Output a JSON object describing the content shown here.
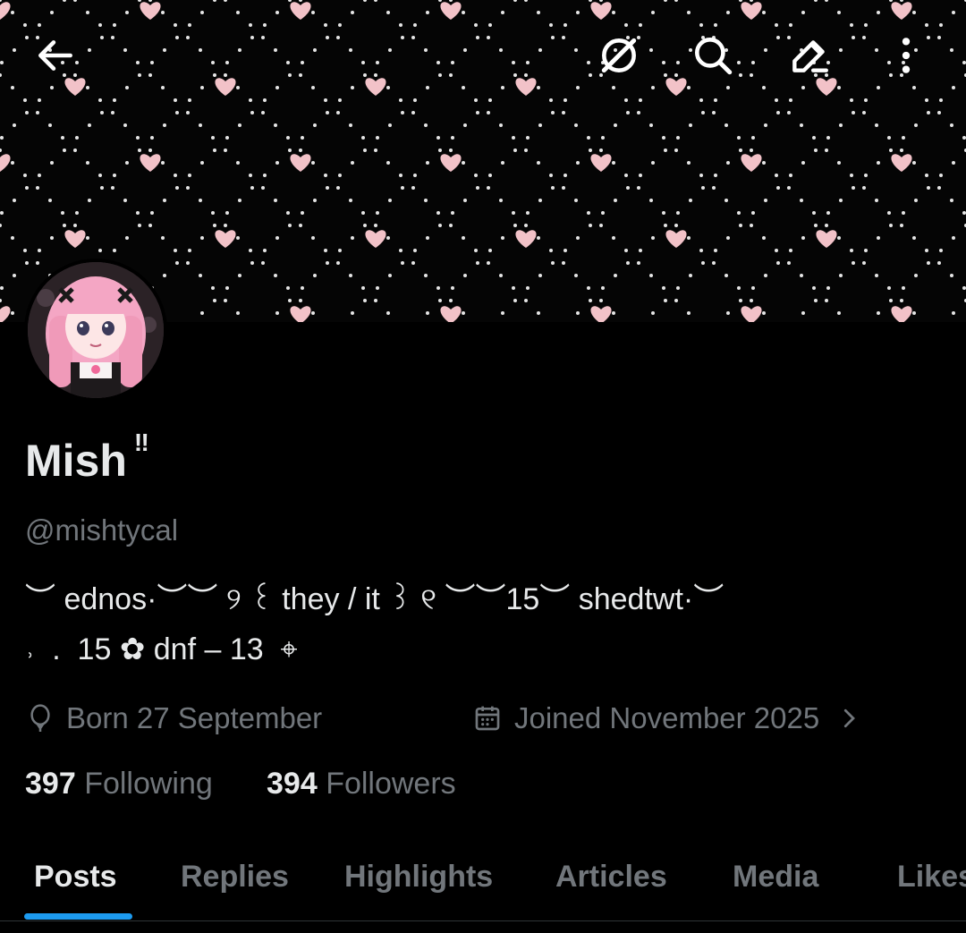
{
  "profile": {
    "display_name": "Mish",
    "name_badge": "‼",
    "handle": "@mishtycal",
    "bio_line1": "︶ ednos·︶︶ ୨ ꒰ they / it ꒱ ୧ ︶︶15︶ shedtwt·︶",
    "bio_line2": "˒  .  15 ✿ dnf – 13  ⌖",
    "birthday": "Born 27 September",
    "joined": "Joined November 2025",
    "following_count": "397",
    "following_label": "Following",
    "followers_count": "394",
    "followers_label": "Followers"
  },
  "topbar": {
    "icons": [
      "back-arrow-icon",
      "grok-icon",
      "search-icon",
      "edit-icon",
      "more-vertical-icon"
    ]
  },
  "tabs": [
    {
      "label": "Posts",
      "active": true
    },
    {
      "label": "Replies"
    },
    {
      "label": "Highlights"
    },
    {
      "label": "Articles"
    },
    {
      "label": "Media"
    },
    {
      "label": "Likes"
    }
  ],
  "colors": {
    "background": "#000000",
    "text_primary": "#e7e9ea",
    "text_secondary": "#71767b",
    "accent": "#1d9bf0",
    "heart_pink": "#f2c2c8"
  }
}
